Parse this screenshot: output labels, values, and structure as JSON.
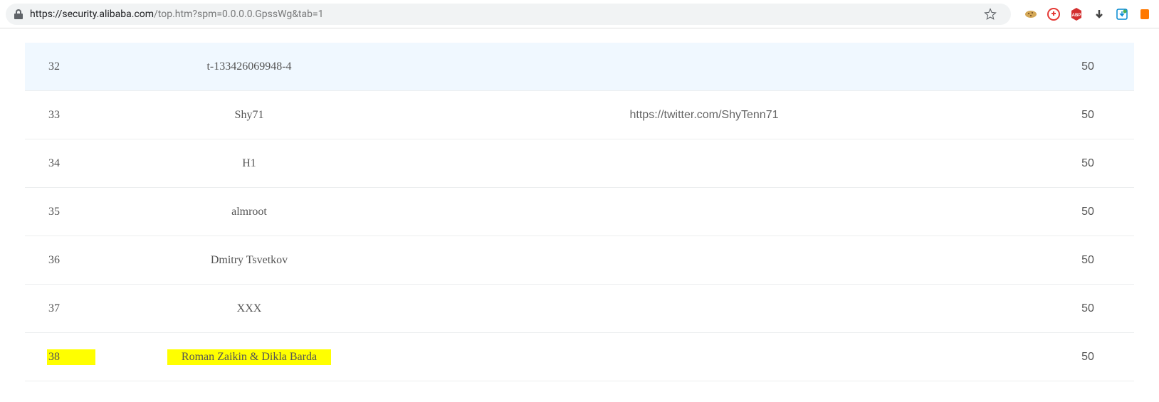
{
  "browser": {
    "url_domain": "https://security.alibaba.com",
    "url_path": "/top.htm?spm=0.0.0.0.GpssWg&tab=1"
  },
  "rows": [
    {
      "rank": "32",
      "name": "t-133426069948-4",
      "link": "",
      "score": "50",
      "highlighted": true
    },
    {
      "rank": "33",
      "name": "Shy71",
      "link": "https://twitter.com/ShyTenn71",
      "score": "50",
      "highlighted": false
    },
    {
      "rank": "34",
      "name": "H1",
      "link": "",
      "score": "50",
      "highlighted": false
    },
    {
      "rank": "35",
      "name": "almroot",
      "link": "",
      "score": "50",
      "highlighted": false
    },
    {
      "rank": "36",
      "name": "Dmitry Tsvetkov",
      "link": "",
      "score": "50",
      "highlighted": false
    },
    {
      "rank": "37",
      "name": "XXX",
      "link": "",
      "score": "50",
      "highlighted": false
    },
    {
      "rank": "38",
      "name": "Roman Zaikin & Dikla Barda",
      "link": "",
      "score": "50",
      "highlighted": false,
      "yellowHighlight": true
    }
  ]
}
